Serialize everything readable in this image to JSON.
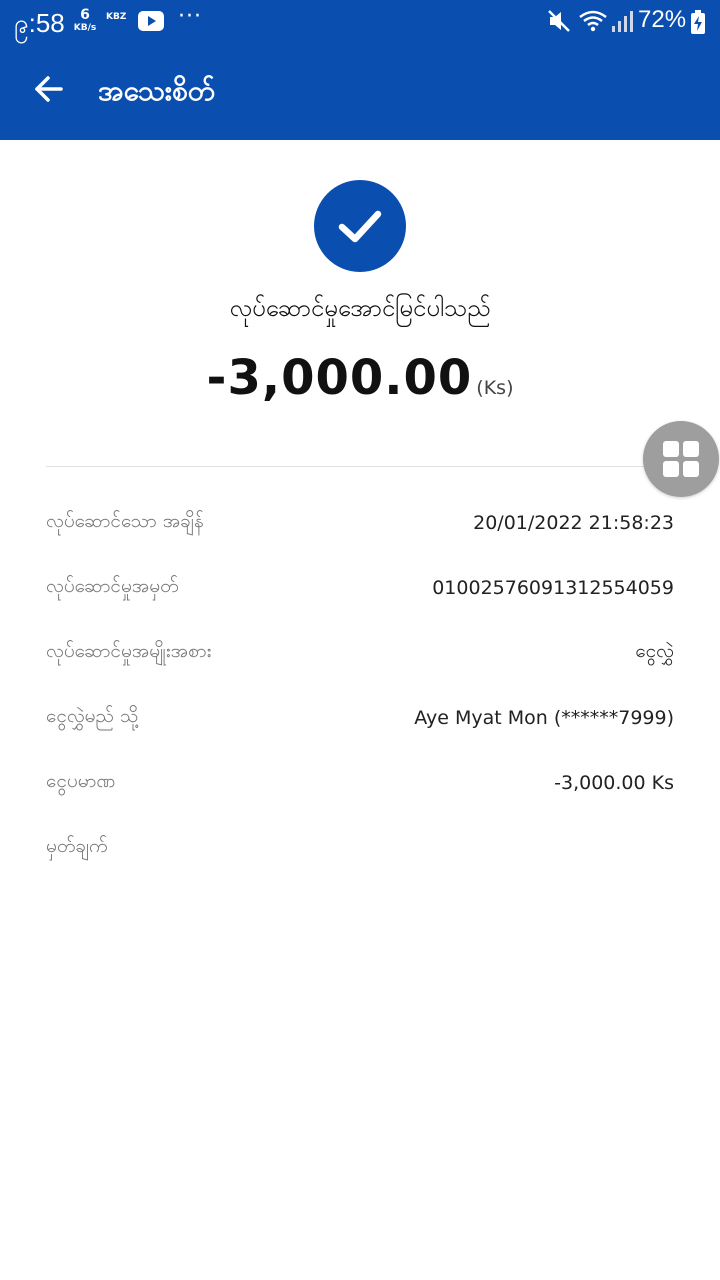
{
  "status_bar": {
    "time": "၉:58",
    "net_speed_value": "6",
    "net_speed_unit": "KB/s",
    "kbz_label": "KBZ",
    "more": "···",
    "battery": "72%"
  },
  "appbar": {
    "title": "အသေးစိတ်"
  },
  "result": {
    "status_text": "လုပ်ဆောင်မှုအောင်မြင်ပါသည်",
    "amount": "-3,000.00",
    "currency": "(Ks)"
  },
  "details": [
    {
      "label": "လုပ်ဆောင်သော အချိန်",
      "value": "20/01/2022 21:58:23"
    },
    {
      "label": "လုပ်ဆောင်မှုအမှတ်",
      "value": "01002576091312554059"
    },
    {
      "label": "လုပ်ဆောင်မှုအမျိုးအစား",
      "value": "ငွေလွှဲ"
    },
    {
      "label": "ငွေလွှဲမည် သို့",
      "value": "Aye Myat Mon (******7999)"
    },
    {
      "label": "ငွေပမာဏ",
      "value": "-3,000.00 Ks"
    },
    {
      "label": "မှတ်ချက်",
      "value": ""
    }
  ],
  "colors": {
    "primary": "#0a4fb0",
    "float_button": "#9e9e9e"
  },
  "icons": {
    "back": "arrow-left-icon",
    "success": "check-icon",
    "menu": "grid-icon"
  }
}
